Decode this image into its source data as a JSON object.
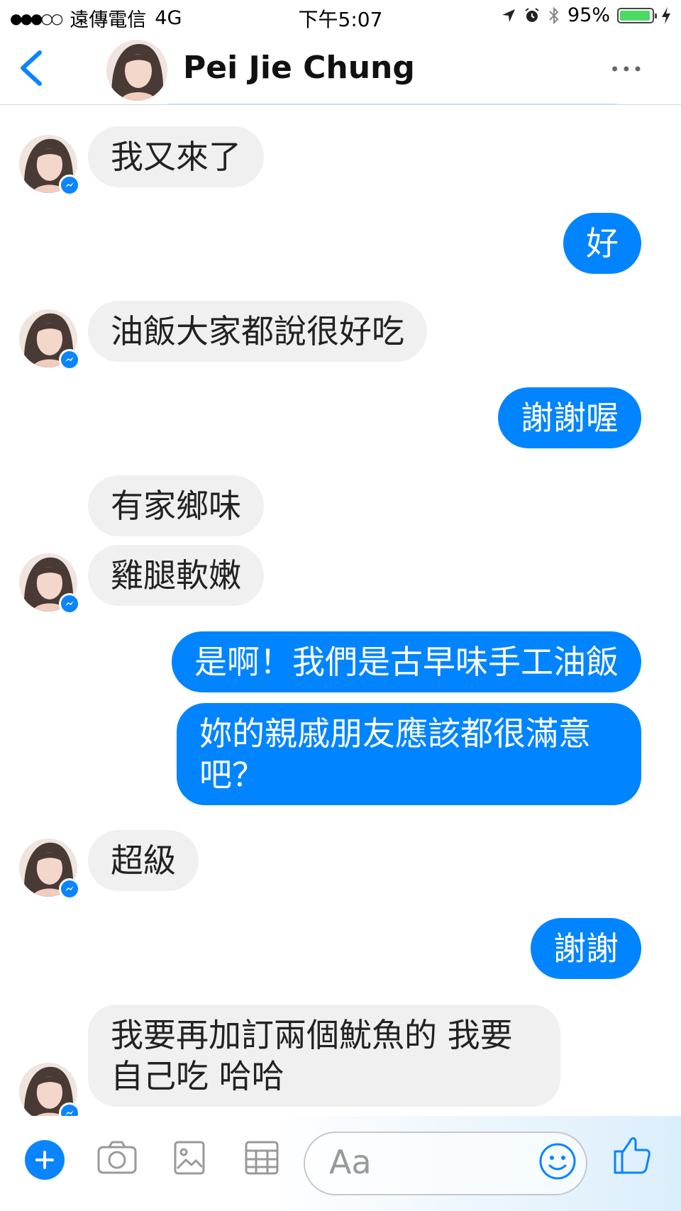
{
  "status_bar": {
    "carrier": "遠傳電信",
    "network": "4G",
    "time": "下午5:07",
    "battery": "95%",
    "battery_level": 0.95
  },
  "header": {
    "contact_name": "Pei Jie Chung",
    "more_label": "•••"
  },
  "messages": [
    {
      "side": "in",
      "text": "我又來了"
    },
    {
      "side": "out",
      "text": "好"
    },
    {
      "side": "in",
      "text": "油飯大家都說很好吃"
    },
    {
      "side": "out",
      "text": "謝謝喔"
    },
    {
      "side": "in",
      "text": "有家鄉味"
    },
    {
      "side": "in",
      "text": "雞腿軟嫩"
    },
    {
      "side": "out",
      "text": "是啊！我們是古早味手工油飯"
    },
    {
      "side": "out",
      "text": "妳的親戚朋友應該都很滿意\n吧？"
    },
    {
      "side": "in",
      "text": "超級"
    },
    {
      "side": "out",
      "text": "謝謝"
    },
    {
      "side": "in",
      "text": "我要再加訂兩個魷魚的 我要\n自己吃 哈哈"
    }
  ],
  "composer": {
    "placeholder": "Aa"
  },
  "colors": {
    "accent": "#0084ff",
    "incoming_bubble": "#f1f0f0"
  }
}
